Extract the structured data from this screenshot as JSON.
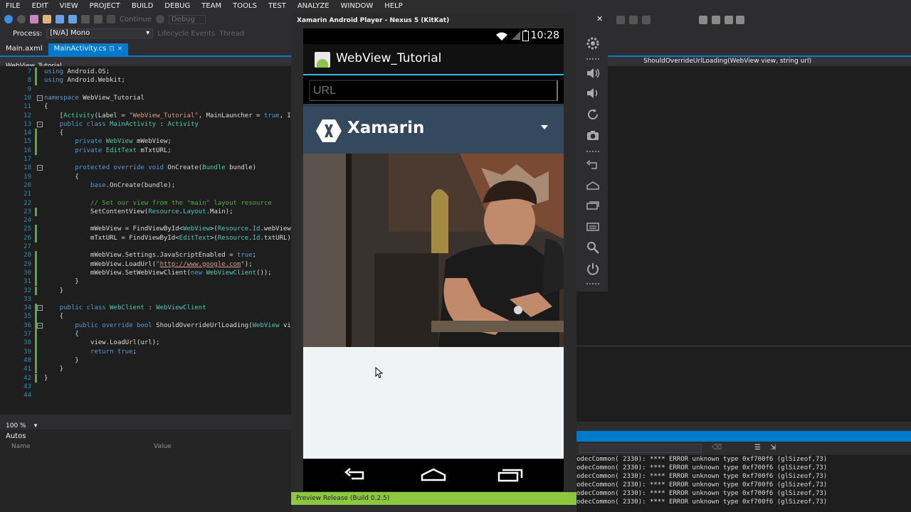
{
  "menu": [
    "FILE",
    "EDIT",
    "VIEW",
    "PROJECT",
    "BUILD",
    "DEBUG",
    "TEAM",
    "TOOLS",
    "TEST",
    "ANALYZE",
    "WINDOW",
    "HELP"
  ],
  "toolbar": {
    "continue_label": "Continue",
    "config_label": "Debug"
  },
  "process": {
    "label": "Process:",
    "value": "[N/A] Mono",
    "lifecycle_label": "Lifecycle Events",
    "thread_label": "Thread"
  },
  "tabs": [
    {
      "label": "Main.axml"
    },
    {
      "label": "MainActivity.cs"
    }
  ],
  "navbar": {
    "class_label": "WebView_Tutorial",
    "member_label": "ShouldOverrideUrlLoading(WebView view, string url)"
  },
  "code_lines": [
    {
      "n": "7",
      "html": "<span class=\"kw\">using</span> Android.OS;"
    },
    {
      "n": "8",
      "html": "<span class=\"kw\">using</span> Android.Webkit;"
    },
    {
      "n": "9",
      "html": ""
    },
    {
      "n": "10",
      "html": "<span class=\"kw\">namespace</span> WebView_Tutorial"
    },
    {
      "n": "11",
      "html": "{"
    },
    {
      "n": "12",
      "html": "    [<span class=\"ty\">Activity</span>(Label = <span class=\"st\">\"WebView_Tutorial\"</span>, MainLauncher = <span class=\"kw\">true</span>, Ic"
    },
    {
      "n": "13",
      "html": "    <span class=\"kw\">public class</span> <span class=\"ty\">MainActivity</span> : <span class=\"ty\">Activity</span>"
    },
    {
      "n": "14",
      "html": "    {"
    },
    {
      "n": "15",
      "html": "        <span class=\"kw\">private</span> <span class=\"ty\">WebView</span> mWebView;"
    },
    {
      "n": "16",
      "html": "        <span class=\"kw\">private</span> <span class=\"ty\">EditText</span> mTxtURL;"
    },
    {
      "n": "17",
      "html": ""
    },
    {
      "n": "18",
      "html": "        <span class=\"kw\">protected override void</span> OnCreate(<span class=\"ty\">Bundle</span> bundle)"
    },
    {
      "n": "19",
      "html": "        {"
    },
    {
      "n": "20",
      "html": "            <span class=\"kw\">base</span>.OnCreate(bundle);"
    },
    {
      "n": "21",
      "html": ""
    },
    {
      "n": "22",
      "html": "            <span class=\"cm\">// Set our view from the \"main\" layout resource</span>"
    },
    {
      "n": "23",
      "html": "            SetContentView(<span class=\"ty\">Resource</span>.<span class=\"ty\">Layout</span>.Main);"
    },
    {
      "n": "24",
      "html": ""
    },
    {
      "n": "25",
      "html": "            mWebView = FindViewById&lt;<span class=\"ty\">WebView</span>&gt;(<span class=\"ty\">Resource</span>.<span class=\"ty\">Id</span>.webView)"
    },
    {
      "n": "26",
      "html": "            mTxtURL = FindViewById&lt;<span class=\"ty\">EditText</span>&gt;(<span class=\"ty\">Resource</span>.<span class=\"ty\">Id</span>.txtURL);"
    },
    {
      "n": "27",
      "html": ""
    },
    {
      "n": "28",
      "html": "            mWebView.Settings.JavaScriptEnabled = <span class=\"kw\">true</span>;"
    },
    {
      "n": "29",
      "html": "            mWebView.LoadUrl(<span class=\"st\">\"</span><span class=\"lk\">http://www.google.com</span><span class=\"st\">\"</span>);"
    },
    {
      "n": "30",
      "html": "            mWebView.SetWebViewClient(<span class=\"kw\">new</span> <span class=\"ty\">WebViewClient</span>());"
    },
    {
      "n": "31",
      "html": "        }"
    },
    {
      "n": "32",
      "html": "    }"
    },
    {
      "n": "33",
      "html": ""
    },
    {
      "n": "34",
      "html": "    <span class=\"kw\">public class</span> <span class=\"ty\">WebClient</span> : <span class=\"ty\">WebViewClient</span>"
    },
    {
      "n": "35",
      "html": "    {"
    },
    {
      "n": "36",
      "html": "        <span class=\"kw\">public override bool</span> ShouldOverrideUrlLoading(<span class=\"ty\">WebView</span> vie"
    },
    {
      "n": "37",
      "html": "        {"
    },
    {
      "n": "38",
      "html": "            view.LoadUrl(url);"
    },
    {
      "n": "39",
      "html": "            <span class=\"kw\">return true</span>;"
    },
    {
      "n": "40",
      "html": "        }"
    },
    {
      "n": "41",
      "html": "    }"
    },
    {
      "n": "42",
      "html": "}"
    },
    {
      "n": "43",
      "html": ""
    },
    {
      "n": "44",
      "html": ""
    }
  ],
  "zoom": "100 %",
  "autos": {
    "title": "Autos",
    "col_name": "Name",
    "col_value": "Value"
  },
  "emulator": {
    "window_title": "Xamarin Android Player - Nexus 5 (KitKat)",
    "clock": "10:28",
    "app_title": "WebView_Tutorial",
    "url_placeholder": "URL",
    "brand": "Xamarin",
    "build_label": "Preview Release (Build 0.2.5)"
  },
  "output_lines": [
    "odecCommon( 2330): **** ERROR unknown type 0xf700f6 (glSizeof,73)",
    "odecCommon( 2330): **** ERROR unknown type 0xf700f6 (glSizeof,73)",
    "odecCommon( 2330): **** ERROR unknown type 0xf700f6 (glSizeof,73)",
    "odecCommon( 2330): **** ERROR unknown type 0xf700f6 (glSizeof,73)",
    "odecCommon( 2330): **** ERROR unknown type 0xf700f6 (glSizeof,73)",
    "odecCommon( 2330): **** ERROR unknown type 0xf700f6 (glSizeof,73)"
  ],
  "colors": {
    "accent": "#007acc",
    "xamarin_header": "#34495e",
    "preview_bar": "#8dc63f",
    "holo_blue": "#33b5e5"
  },
  "icons": [
    "settings-gear-icon",
    "volume-up-icon",
    "volume-down-icon",
    "rotate-icon",
    "camera-icon",
    "back-icon",
    "home-icon",
    "recents-icon",
    "menu-icon",
    "search-icon",
    "power-icon"
  ]
}
